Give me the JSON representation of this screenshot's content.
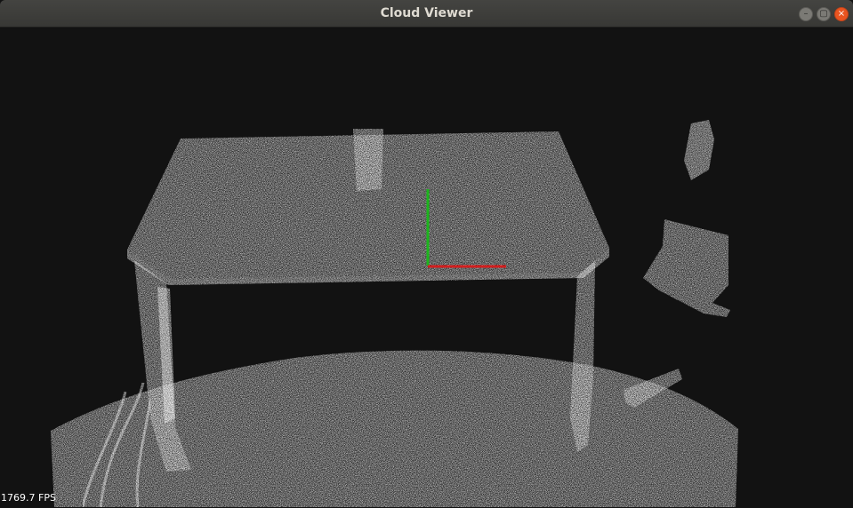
{
  "window": {
    "title": "Cloud Viewer",
    "buttons": {
      "minimize": "–",
      "maximize": "▢",
      "close": "×"
    }
  },
  "viewport": {
    "fps": "1769.7 FPS",
    "background_color": "#121212",
    "point_color": "#ffffff",
    "axes": {
      "x_color": "#d21e1e",
      "y_color": "#1eb41e"
    }
  }
}
